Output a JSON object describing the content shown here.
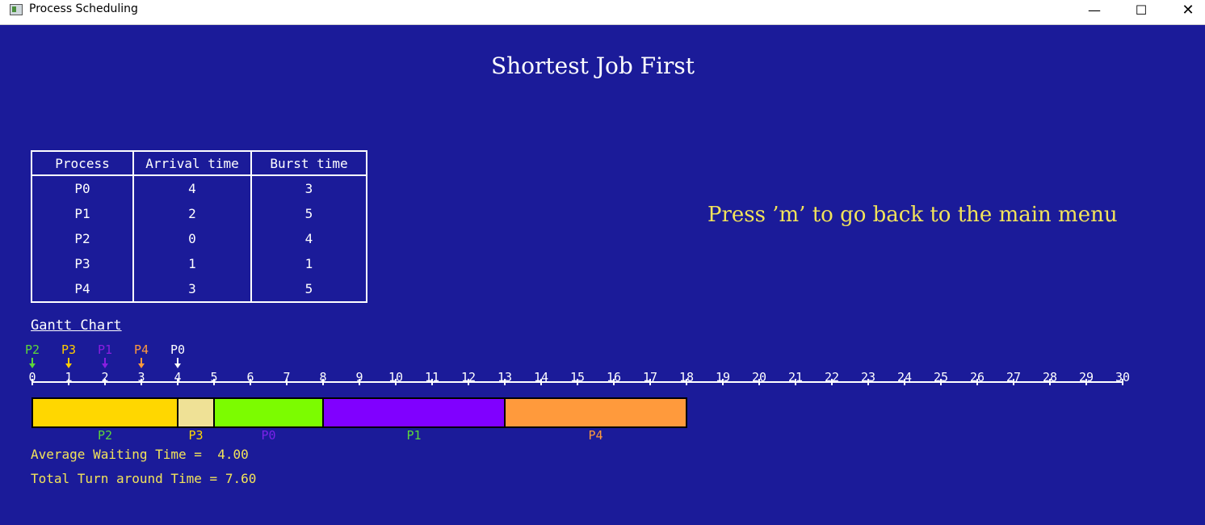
{
  "window": {
    "title": "Process Scheduling",
    "minimize_glyph": "—",
    "maximize_glyph": "☐",
    "close_glyph": "✕"
  },
  "heading": "Shortest Job First",
  "hint": "Press ’m’ to go back to the main menu",
  "process_table": {
    "headers": [
      "Process",
      "Arrival time",
      "Burst time"
    ],
    "rows": [
      [
        "P0",
        "4",
        "3"
      ],
      [
        "P1",
        "2",
        "5"
      ],
      [
        "P2",
        "0",
        "4"
      ],
      [
        "P3",
        "1",
        "1"
      ],
      [
        "P4",
        "3",
        "5"
      ]
    ]
  },
  "gantt": {
    "label": "Gantt Chart",
    "axis_max": 30,
    "arrivals": [
      {
        "process": "P2",
        "time": 0,
        "color": "#5dd83a"
      },
      {
        "process": "P3",
        "time": 1,
        "color": "#ffcc00"
      },
      {
        "process": "P1",
        "time": 2,
        "color": "#8a1ee0"
      },
      {
        "process": "P4",
        "time": 3,
        "color": "#ff9a3c"
      },
      {
        "process": "P0",
        "time": 4,
        "color": "#ffffff"
      }
    ],
    "blocks": [
      {
        "process": "P2",
        "start": 0,
        "end": 4,
        "color": "#ffd700",
        "label_color": "#5dd83a"
      },
      {
        "process": "P3",
        "start": 4,
        "end": 5,
        "color": "#efe196",
        "label_color": "#ffd700"
      },
      {
        "process": "P0",
        "start": 5,
        "end": 8,
        "color": "#7cfc00",
        "label_color": "#7a22e8"
      },
      {
        "process": "P1",
        "start": 8,
        "end": 13,
        "color": "#8000ff",
        "label_color": "#5dd83a"
      },
      {
        "process": "P4",
        "start": 13,
        "end": 18,
        "color": "#ff9a3c",
        "label_color": "#ff9a3c"
      }
    ]
  },
  "stats": {
    "avg_waiting": "Average Waiting Time =  4.00",
    "total_turnaround": "Total Turn around Time = 7.60"
  }
}
